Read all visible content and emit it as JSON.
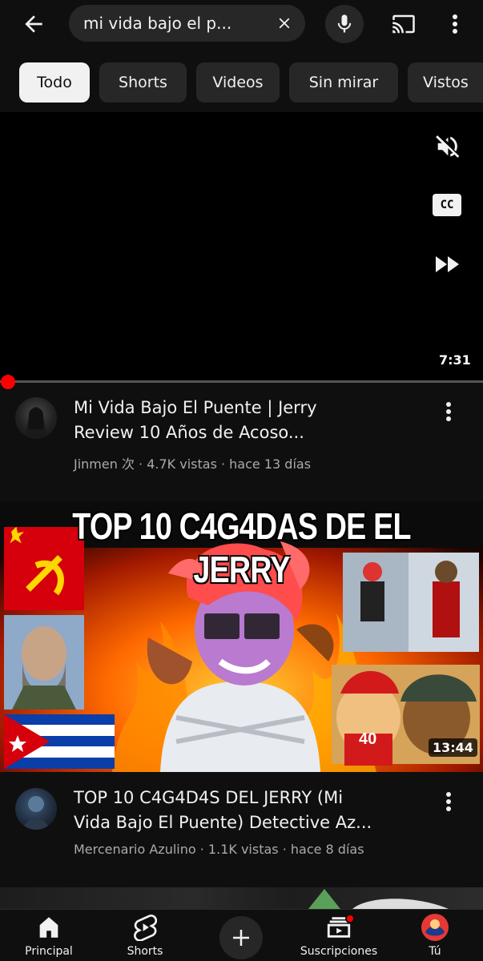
{
  "search": {
    "query": "mi vida bajo el p...",
    "back_icon": "arrow-left-icon",
    "clear_icon": "close-icon",
    "mic_icon": "microphone-icon",
    "cast_icon": "cast-icon",
    "more_icon": "more-vertical-icon"
  },
  "chips": [
    {
      "label": "Todo",
      "active": true
    },
    {
      "label": "Shorts",
      "active": false
    },
    {
      "label": "Videos",
      "active": false
    },
    {
      "label": "Sin mirar",
      "active": false
    },
    {
      "label": "Vistos",
      "active": false
    }
  ],
  "player": {
    "duration": "7:31",
    "cc_label": "CC",
    "progress": 0
  },
  "videos": [
    {
      "title": "Mi Vida Bajo El Puente | Jerry Review 10 Años de Acoso...",
      "title_line1": "Mi Vida Bajo El Puente | Jerry",
      "title_line2": "Review 10 Años de Acoso...",
      "channel": "Jinmen 次",
      "views": "4.7K vistas",
      "age": "hace 13 días",
      "meta": "Jinmen 次 · 4.7K vistas · hace 13 días"
    },
    {
      "thumbnail_text": "TOP 10 C4G4DAS DE EL JERRY",
      "title_line1": "TOP 10 C4G4D4S DEL JERRY (Mi",
      "title_line2": "Vida Bajo El Puente) Detective Az...",
      "channel": "Mercenario Azulino",
      "views": "1.1K vistas",
      "age": "hace 8 días",
      "meta": "Mercenario Azulino · 1.1K vistas · hace 8 días",
      "duration": "13:44",
      "thumb_small_text": "40"
    }
  ],
  "bottom_nav": [
    {
      "label": "Principal",
      "icon": "home-icon"
    },
    {
      "label": "Shorts",
      "icon": "shorts-icon"
    },
    {
      "label": "",
      "icon": "plus-icon"
    },
    {
      "label": "Suscripciones",
      "icon": "subscriptions-icon"
    },
    {
      "label": "Tú",
      "icon": "avatar-icon"
    }
  ],
  "colors": {
    "background": "#0f0f0f",
    "chip": "#272727",
    "chip_active": "#f1f1f1",
    "accent_red": "#ff0000",
    "meta_text": "#aaaaaa"
  }
}
